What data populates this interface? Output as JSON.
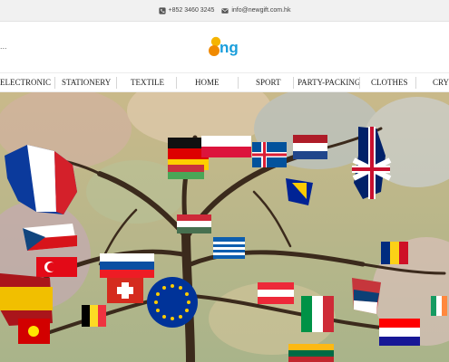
{
  "topbar": {
    "phone": "+852 3460 3245",
    "email": "info@newgift.com.hk",
    "phone_icon": "phone-icon",
    "email_icon": "envelope-icon"
  },
  "header": {
    "menu_text": "...",
    "logo_text": "ng"
  },
  "nav": {
    "items": [
      "ELECTRONIC",
      "STATIONERY",
      "TEXTILE",
      "HOME",
      "SPORT",
      "PARTY-PACKING",
      "CLOTHES",
      "CRYS"
    ]
  },
  "hero": {
    "description_icon": "tree-of-european-flags-illustration",
    "colors": {
      "accent": "#1a9edb",
      "logo_yellow": "#f5b400",
      "trunk": "#3b2a1c"
    }
  }
}
